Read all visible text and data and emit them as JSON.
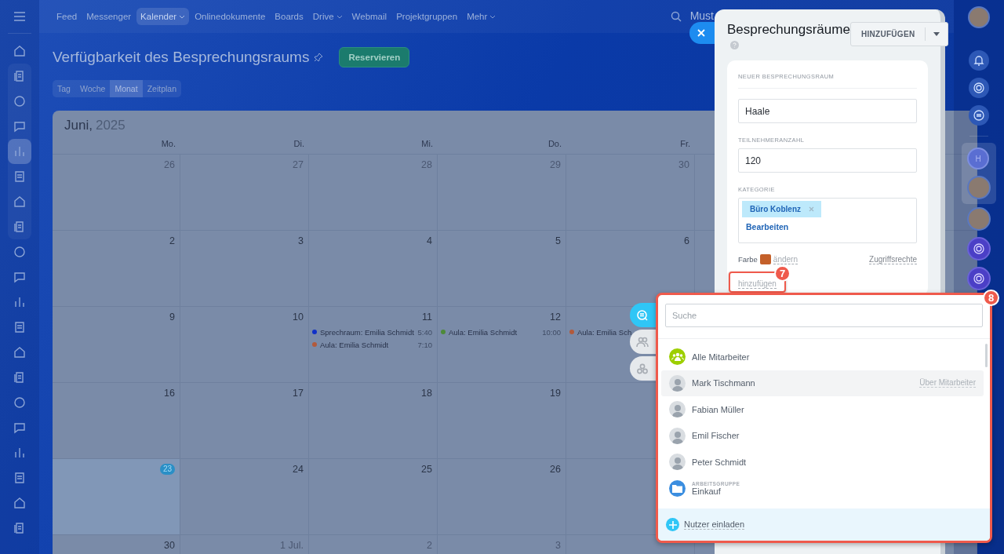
{
  "left_sidebar": {
    "items": [
      {
        "selected": false
      },
      {
        "selected": false
      },
      {
        "selected": false
      },
      {
        "selected": false
      },
      {
        "selected": true
      },
      {
        "selected": false
      },
      {
        "selected": false
      },
      {
        "selected": false
      },
      {
        "selected": false
      },
      {
        "selected": false
      },
      {
        "selected": false
      },
      {
        "selected": false
      },
      {
        "selected": false
      },
      {
        "selected": false
      },
      {
        "selected": false
      },
      {
        "selected": false
      },
      {
        "selected": false
      },
      {
        "selected": false
      },
      {
        "selected": false
      },
      {
        "selected": false
      }
    ]
  },
  "top_nav": {
    "items": [
      {
        "label": "Feed",
        "selected": false,
        "dropdown": false
      },
      {
        "label": "Messenger",
        "selected": false,
        "dropdown": false
      },
      {
        "label": "Kalender",
        "selected": true,
        "dropdown": true
      },
      {
        "label": "Onlinedokumente",
        "selected": false,
        "dropdown": false
      },
      {
        "label": "Boards",
        "selected": false,
        "dropdown": false
      },
      {
        "label": "Drive",
        "selected": false,
        "dropdown": true
      },
      {
        "label": "Webmail",
        "selected": false,
        "dropdown": false
      },
      {
        "label": "Projektgruppen",
        "selected": false,
        "dropdown": false
      },
      {
        "label": "Mehr",
        "selected": false,
        "dropdown": true
      }
    ],
    "user_name": "Must"
  },
  "page": {
    "title": "Verfügbarkeit des Besprechungsraums",
    "primary_button": "Reservieren",
    "view_tabs": [
      {
        "label": "Tag",
        "selected": false
      },
      {
        "label": "Woche",
        "selected": false
      },
      {
        "label": "Monat",
        "selected": true
      },
      {
        "label": "Zeitplan",
        "selected": false
      }
    ]
  },
  "calendar": {
    "month": "Juni,",
    "year": "2025",
    "weekdays": [
      "Mo.",
      "Di.",
      "Mi.",
      "Do.",
      "Fr."
    ],
    "weeks": [
      {
        "days": [
          {
            "day": "26",
            "muted": true
          },
          {
            "day": "27",
            "muted": true
          },
          {
            "day": "28",
            "muted": true
          },
          {
            "day": "29",
            "muted": true
          },
          {
            "day": "30",
            "muted": true
          }
        ]
      },
      {
        "days": [
          {
            "day": "2",
            "muted": false
          },
          {
            "day": "3",
            "muted": false
          },
          {
            "day": "4",
            "muted": false
          },
          {
            "day": "5",
            "muted": false
          },
          {
            "day": "6",
            "muted": false
          }
        ]
      },
      {
        "days": [
          {
            "day": "9",
            "muted": false
          },
          {
            "day": "10",
            "muted": false
          },
          {
            "day": "11",
            "muted": false,
            "events": [
              {
                "title": "Sprechraum: Emilia Schmidt",
                "time": "5:40",
                "color": "#1030c8"
              },
              {
                "title": "Aula: Emilia Schmidt",
                "time": "7:10",
                "color": "#b25a3c"
              }
            ]
          },
          {
            "day": "12",
            "muted": false,
            "events": [
              {
                "title": "Aula: Emilia Schmidt",
                "time": "10:00",
                "color": "#4e8a3a"
              }
            ]
          },
          {
            "events": [
              {
                "title": "Aula: Emilia Sch",
                "color": "#b25a3c"
              }
            ]
          }
        ]
      },
      {
        "days": [
          {
            "day": "16",
            "muted": false
          },
          {
            "day": "17",
            "muted": false
          },
          {
            "day": "18",
            "muted": false
          },
          {
            "day": "19",
            "muted": false
          }
        ]
      },
      {
        "days": [
          {
            "day": "23",
            "muted": false,
            "today": true
          },
          {
            "day": "24",
            "muted": false
          },
          {
            "day": "25",
            "muted": false
          },
          {
            "day": "26",
            "muted": false
          }
        ]
      },
      {
        "days": [
          {
            "day": "30",
            "muted": false
          },
          {
            "day": "1 Jul.",
            "muted": true
          },
          {
            "day": "2",
            "muted": true
          },
          {
            "day": "3",
            "muted": true
          }
        ]
      }
    ]
  },
  "panel": {
    "title": "Besprechungsräume",
    "add_button": "HINZUFÜGEN",
    "section_title": "NEUER BESPRECHUNGSRAUM",
    "name_value": "Haale",
    "capacity_label": "TEILNEHMERANZAHL",
    "capacity_value": "120",
    "category_label": "KATEGORIE",
    "category_tag": "Büro Koblenz",
    "edit_link": "Bearbeiten",
    "color_label": "Farbe",
    "color": "#c4602a",
    "change_link": "ändern",
    "access_link": "Zugriffsrechte",
    "add_link": "hinzufügen"
  },
  "right_rail": {
    "group_avatar_letter": "H"
  },
  "selector_popup": {
    "search_placeholder": "Suche",
    "side_tabs": [
      {
        "selected": true
      },
      {
        "selected": false
      },
      {
        "selected": false
      }
    ],
    "items": [
      {
        "kind": "group",
        "name": "Alle Mitarbeiter",
        "highlighted": false
      },
      {
        "kind": "user",
        "name": "Mark Tischmann",
        "highlighted": true,
        "hint": "Über Mitarbeiter"
      },
      {
        "kind": "user",
        "name": "Fabian Müller",
        "highlighted": false
      },
      {
        "kind": "user",
        "name": "Emil Fischer",
        "highlighted": false
      },
      {
        "kind": "user",
        "name": "Peter Schmidt",
        "highlighted": false
      },
      {
        "kind": "workgroup",
        "name": "Einkauf",
        "caption": "ARBEITSGRUPPE",
        "highlighted": false
      }
    ],
    "invite_link": "Nutzer einladen"
  },
  "annotations": [
    {
      "number": "7"
    },
    {
      "number": "8"
    }
  ]
}
